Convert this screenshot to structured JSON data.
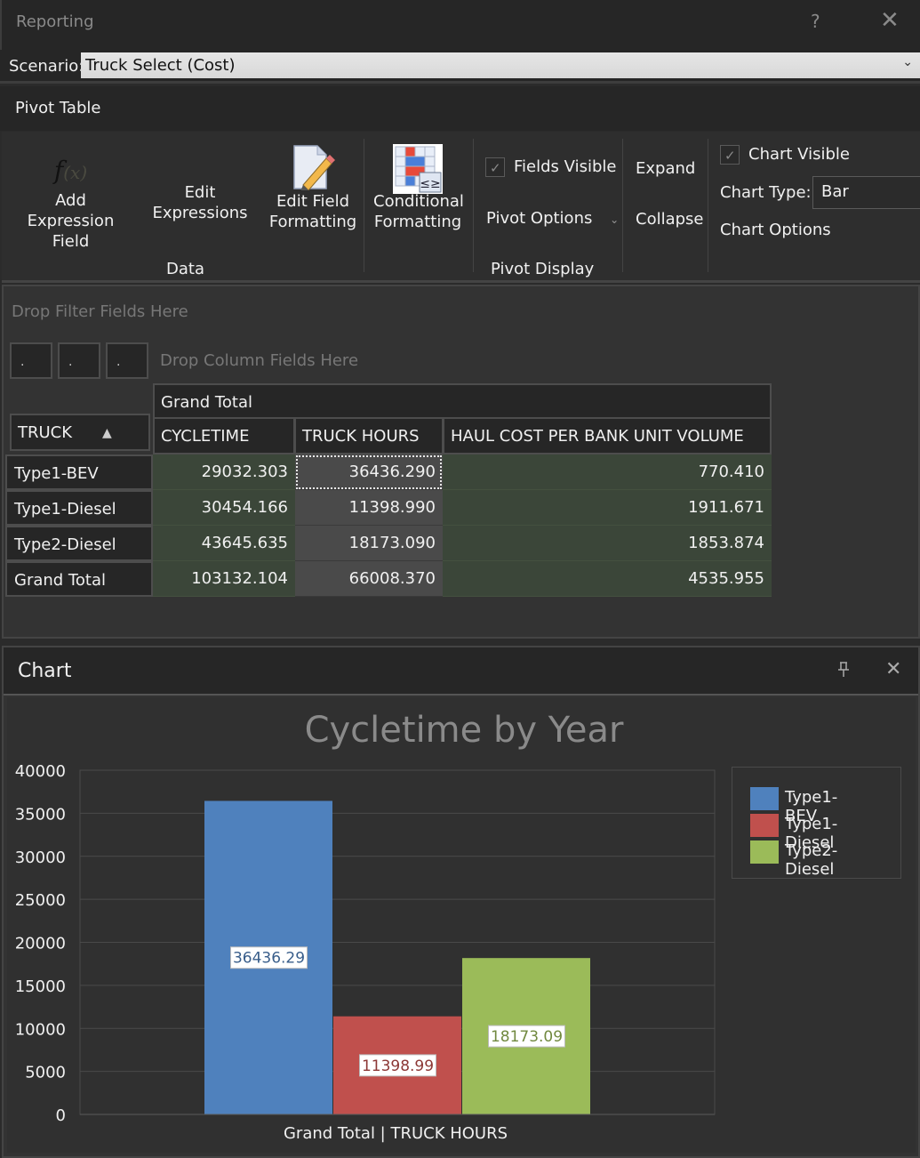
{
  "window": {
    "title": "Reporting",
    "help_icon": "?",
    "close_icon": "✕"
  },
  "scenario": {
    "label": "Scenario:",
    "value": "Truck Select (Cost)",
    "dropdown_icon": "⌄"
  },
  "ribbon": {
    "tab": "Pivot Table",
    "data_group": {
      "label": "Data",
      "add_expression_field": "Add Expression Field",
      "add_expression_line1": "Add Expression",
      "add_expression_line2": "Field",
      "edit_expressions": "Edit Expressions",
      "edit_field_formatting_line1": "Edit Field",
      "edit_field_formatting_line2": "Formatting"
    },
    "pivot_display_group": {
      "label": "Pivot Display",
      "conditional_formatting_line1": "Conditional",
      "conditional_formatting_line2": "Formatting",
      "fields_visible": {
        "label": "Fields Visible",
        "checked": true
      },
      "pivot_options": "Pivot Options",
      "expand": "Expand",
      "collapse": "Collapse"
    },
    "chart_group": {
      "chart_visible": {
        "label": "Chart Visible",
        "checked": true
      },
      "chart_type_label": "Chart Type:",
      "chart_type_value": "Bar",
      "chart_options": "Chart Options"
    }
  },
  "pivot": {
    "drop_filter": "Drop Filter Fields Here",
    "drop_column": "Drop Column Fields Here",
    "data_field_buttons": [
      ".",
      ".",
      "."
    ],
    "row_field": "TRUCK",
    "column_group": "Grand Total",
    "columns": [
      "CYCLETIME",
      "TRUCK HOURS",
      "HAUL COST PER BANK UNIT VOLUME"
    ],
    "rows": [
      {
        "label": "Type1-BEV",
        "values": [
          "29032.303",
          "36436.290",
          "770.410"
        ]
      },
      {
        "label": "Type1-Diesel",
        "values": [
          "30454.166",
          "11398.990",
          "1911.671"
        ]
      },
      {
        "label": "Type2-Diesel",
        "values": [
          "43645.635",
          "18173.090",
          "1853.874"
        ]
      },
      {
        "label": "Grand Total",
        "values": [
          "103132.104",
          "66008.370",
          "4535.955"
        ]
      }
    ],
    "focused_cell": {
      "row": 0,
      "col": 1
    }
  },
  "chart_panel": {
    "title": "Chart",
    "pin_icon": "⍖",
    "close_icon": "✕"
  },
  "chart_data": {
    "type": "bar",
    "title": "Cycletime by Year",
    "categories": [
      "Grand Total | TRUCK HOURS"
    ],
    "xlabel": "Grand Total | TRUCK HOURS",
    "ylabel": "",
    "ylim": [
      0,
      40000
    ],
    "yticks": [
      0,
      5000,
      10000,
      15000,
      20000,
      25000,
      30000,
      35000,
      40000
    ],
    "grid": true,
    "legend_position": "right",
    "series": [
      {
        "name": "Type1-BEV",
        "values": [
          36436.29
        ],
        "label": "36436.29",
        "color": "#4f81bd"
      },
      {
        "name": "Type1-Diesel",
        "values": [
          11398.99
        ],
        "label": "11398.99",
        "color": "#c0504d"
      },
      {
        "name": "Type2-Diesel",
        "values": [
          18173.09
        ],
        "label": "18173.09",
        "color": "#9bbb59"
      }
    ]
  }
}
